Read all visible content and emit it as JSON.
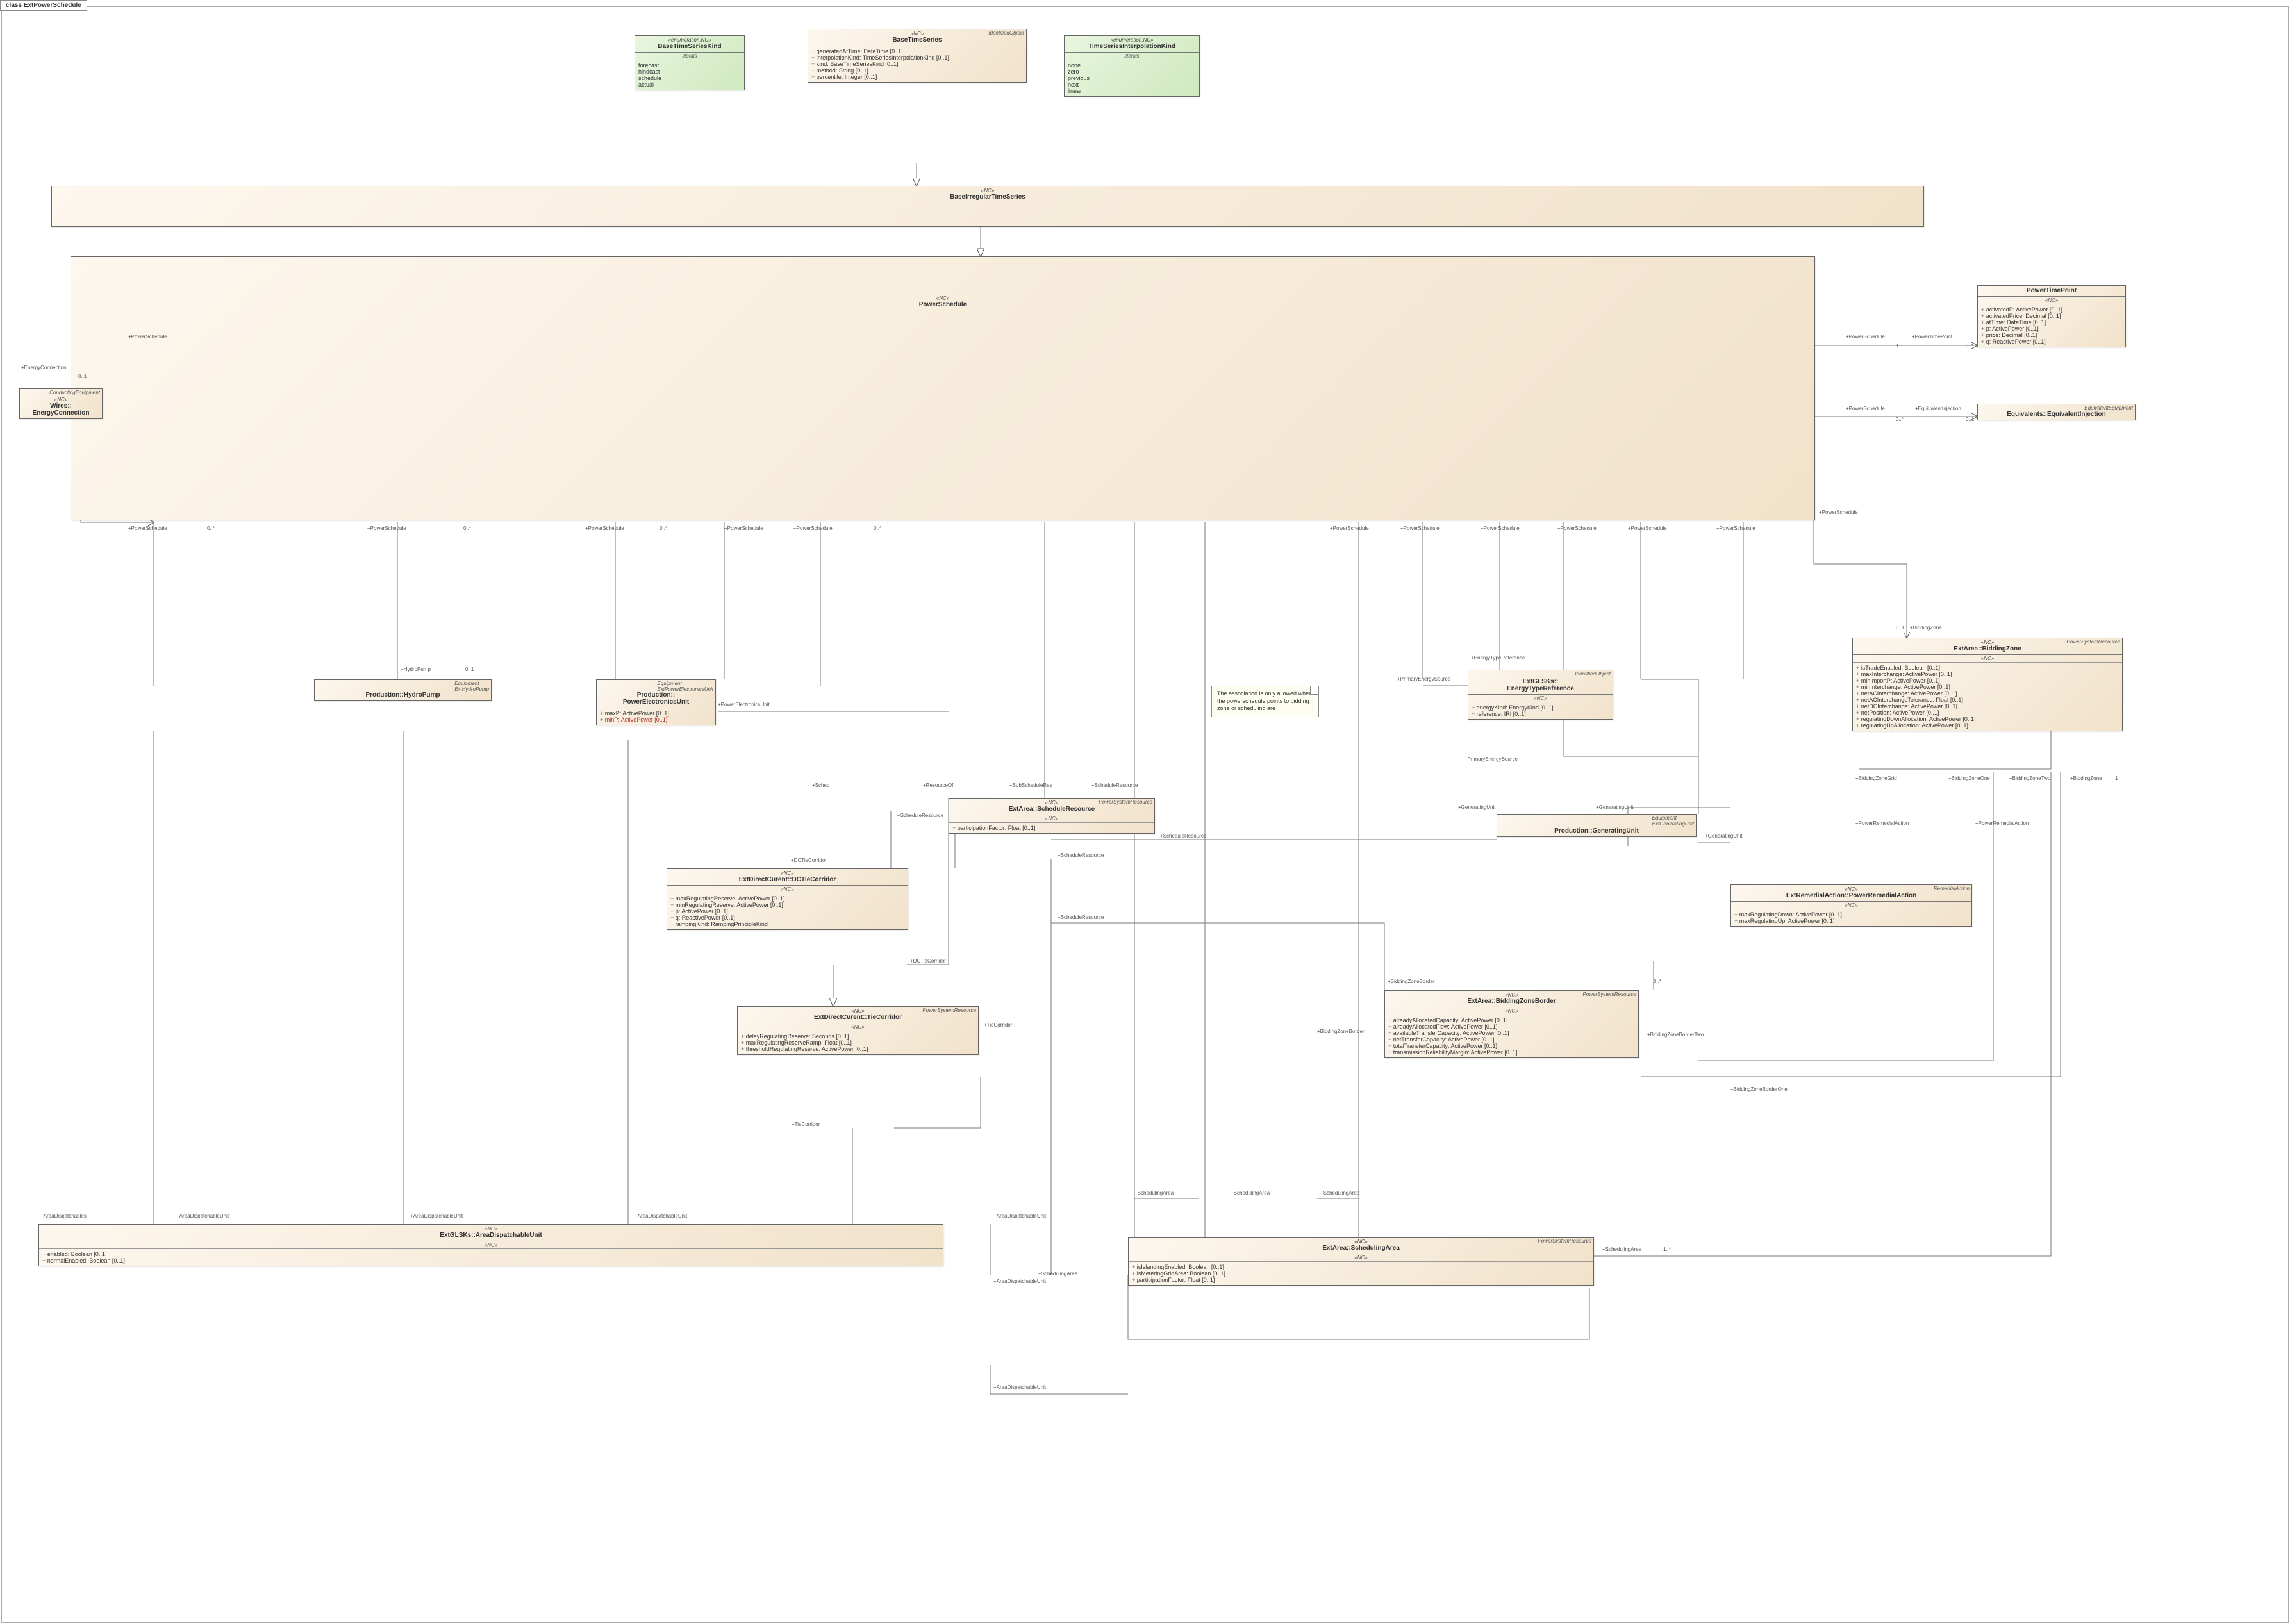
{
  "diagram": {
    "title": "class ExtPowerSchedule"
  },
  "note": {
    "text": "The association is only allowed when the powerschedule points to bidding zone or scheduling are"
  },
  "labels": {
    "powerSchedule": "+PowerSchedule",
    "powerTimePoint": "+PowerTimePoint",
    "equivalentInjection": "+EquivalentInjection",
    "energyConnection": "+EnergyConnection",
    "hydroPump": "+HydroPump",
    "powerElectronicsUnit": "+PowerElectronicsUnit",
    "generatingUnit": "+GeneratingUnit",
    "dcTieCorridor": "+DCTieCorridor",
    "tieCorridor": "+TieCorridor",
    "scheduleResource": "+ScheduleResource",
    "subScheduleRes": "+SubScheduleRes",
    "resourceOf": "+ResourceOf",
    "areaDispatchableUnit": "+AreaDispatchableUnit",
    "areaDispatchables": "+AreaDispatchables",
    "schedulingArea": "+SchedulingArea",
    "biddingZone": "+BiddingZone",
    "biddingZoneBorder": "+BiddingZoneBorder",
    "biddingZoneBorderOne": "+BiddingZoneBorderOne",
    "biddingZoneBorderTwo": "+BiddingZoneBorderTwo",
    "biddingZoneOne": "+BiddingZoneOne",
    "biddingZoneTwo": "+BiddingZoneTwo",
    "biddingZoneGrid": "+BiddingZoneGrid",
    "powerRemedialAction": "+PowerRemedialAction",
    "primaryEnergySource": "+PrimaryEnergySource",
    "energyTypeReference": "+EnergyTypeReference",
    "sched": "+Sched",
    "m01": "0..1",
    "m0n": "0..*",
    "m1": "1",
    "m1n": "1..*"
  },
  "classes": {
    "BaseTimeSeriesKind": {
      "stereo": "«enumeration,NC»",
      "corner": "",
      "name": "BaseTimeSeriesKind",
      "literalsHeader": "literals",
      "literals": [
        "forecast",
        "hindcast",
        "schedule",
        "actual"
      ]
    },
    "TimeSeriesInterpolationKind": {
      "stereo": "«enumeration,NC»",
      "corner": "",
      "name": "TimeSeriesInterpolationKind",
      "literalsHeader": "literals",
      "literals": [
        "none",
        "zero",
        "previous",
        "next",
        "linear"
      ]
    },
    "BaseTimeSeries": {
      "stereo": "«NC»",
      "corner": "IdentifiedObject",
      "name": "BaseTimeSeries",
      "attrs": [
        "generatedAtTime: DateTime [0..1]",
        "interpolationKind: TimeSeriesInterpolationKind [0..1]",
        "kind: BaseTimeSeriesKind [0..1]",
        "method: String [0..1]",
        "percentile: Integer [0..1]"
      ]
    },
    "BaseIrregularTimeSeries": {
      "stereo": "«NC»",
      "name": "BaseIrregularTimeSeries"
    },
    "PowerSchedule": {
      "stereo": "«NC»",
      "name": "PowerSchedule"
    },
    "PowerTimePoint": {
      "stereo": "«NC»",
      "corner": "",
      "name": "PowerTimePoint",
      "attrsHeader": "«NC»",
      "attrs": [
        "activatedP: ActivePower [0..1]",
        "activatedPrice: Decimal [0..1]",
        "atTime: DateTime [0..1]",
        "p: ActivePower [0..1]",
        "price: Decimal [0..1]",
        "q: ReactivePower [0..1]"
      ]
    },
    "EquivalentInjection": {
      "stereo": "",
      "corner": "EquivalentEquipment",
      "name": "Equivalents::EquivalentInjection"
    },
    "EnergyConnection": {
      "stereo": "«NC»",
      "corner": "ConductingEquipment",
      "name": "Wires::\nEnergyConnection"
    },
    "HydroPump": {
      "stereo": "",
      "corner": "Equipment\nExtHydroPump",
      "name": "Production::HydroPump"
    },
    "PowerElectronicsUnit": {
      "stereo": "",
      "corner": "Equipment\nExtPowerElectronicsUnit",
      "name": "Production::\nPowerElectronicsUnit",
      "attrs": [
        "maxP: ActivePower [0..1]",
        "minP: ActivePower [0..1]"
      ],
      "redAttrs": [
        false,
        true
      ]
    },
    "ScheduleResource": {
      "stereo": "«NC»",
      "corner": "PowerSystemResource",
      "name": "ExtArea::ScheduleResource",
      "attrsHeader": "«NC»",
      "attrs": [
        "participationFactor: Float [0..1]"
      ]
    },
    "EnergyTypeReference": {
      "stereo": "",
      "corner": "IdentifiedObject",
      "name": "ExtGLSKs::\nEnergyTypeReference",
      "attrsHeader": "«NC»",
      "attrs": [
        "energyKind: EnergyKind [0..1]",
        "reference: IRI [0..1]"
      ]
    },
    "GeneratingUnit": {
      "stereo": "",
      "corner": "Equipment\nExtGeneratingUnit",
      "name": "Production::GeneratingUnit"
    },
    "BiddingZone": {
      "stereo": "«NC»",
      "corner": "PowerSystemResource",
      "name": "ExtArea::BiddingZone",
      "attrsHeader": "«NC»",
      "attrs": [
        "isTradeEnabled: Boolean [0..1]",
        "maxInterchange: ActivePower [0..1]",
        "minImportP: ActivePower [0..1]",
        "minInterchange: ActivePower [0..1]",
        "netACInterchange: ActivePower [0..1]",
        "netACInterchangeTolerance: Float [0..1]",
        "netDCInterchange: ActivePower [0..1]",
        "netPosition: ActivePower [0..1]",
        "regulatingDownAllocation: ActivePower [0..1]",
        "regulatingUpAllocation: ActivePower [0..1]"
      ]
    },
    "DCTieCorridor": {
      "stereo": "«NC»",
      "corner": "",
      "name": "ExtDirectCurent::DCTieCorridor",
      "attrsHeader": "«NC»",
      "attrs": [
        "maxRegulatingReserve: ActivePower [0..1]",
        "minRegulatingReserve: ActivePower [0..1]",
        "p: ActivePower [0..1]",
        "q: ReactivePower [0..1]",
        "rampingKind: RampingPrincipleKind"
      ]
    },
    "TieCorridor": {
      "stereo": "«NC»",
      "corner": "PowerSystemResource",
      "name": "ExtDirectCurent::TieCorridor",
      "attrsHeader": "«NC»",
      "attrs": [
        "delayRegulatingReserve: Seconds [0..1]",
        "maxRegulatingReserveRamp: Float [0..1]",
        "thresholdRegulatingReserve: ActivePower [0..1]"
      ]
    },
    "PowerRemedialAction": {
      "stereo": "«NC»",
      "corner": "RemedialAction",
      "name": "ExtRemedialAction::PowerRemedialAction",
      "attrsHeader": "«NC»",
      "attrs": [
        "maxRegulatingDown: ActivePower [0..1]",
        "maxRegulatingUp: ActivePower [0..1]"
      ]
    },
    "BiddingZoneBorder": {
      "stereo": "«NC»",
      "corner": "PowerSystemResource",
      "name": "ExtArea::BiddingZoneBorder",
      "attrsHeader": "«NC»",
      "attrs": [
        "alreadyAllocatedCapacity: ActivePower [0..1]",
        "alreadyAllocatedFlow: ActivePower [0..1]",
        "availableTransferCapacity: ActivePower [0..1]",
        "netTransferCapacity: ActivePower [0..1]",
        "totalTransferCapacity: ActivePower [0..1]",
        "transmissionReliabilityMargin: ActivePower [0..1]"
      ]
    },
    "AreaDispatchableUnit": {
      "stereo": "«NC»",
      "corner": "",
      "name": "ExtGLSKs::AreaDispatchableUnit",
      "attrsHeader": "«NC»",
      "attrs": [
        "enabled: Boolean [0..1]",
        "normalEnabled: Boolean [0..1]"
      ]
    },
    "SchedulingArea": {
      "stereo": "«NC»",
      "corner": "PowerSystemResource",
      "name": "ExtArea::SchedulingArea",
      "attrsHeader": "«NC»",
      "attrs": [
        "isIslandingEnabled: Boolean [0..1]",
        "isMeteringGridArea: Boolean [0..1]",
        "participationFactor: Float [0..1]"
      ]
    }
  }
}
